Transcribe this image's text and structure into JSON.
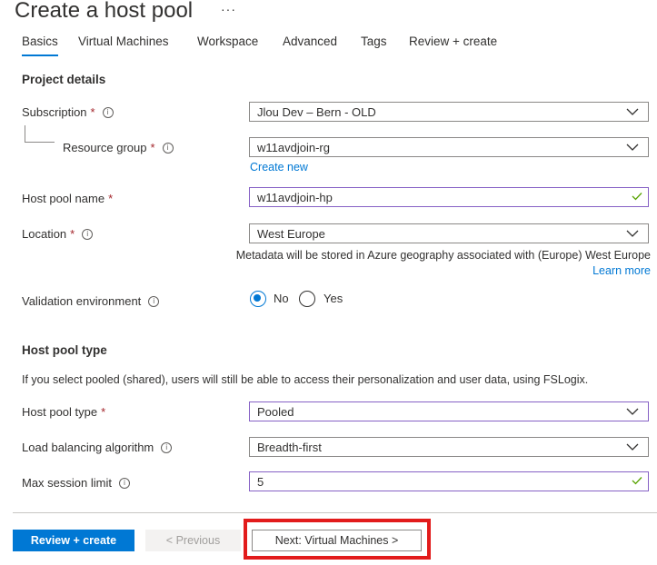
{
  "header": {
    "title": "Create a host pool",
    "more": "···"
  },
  "tabs": [
    {
      "label": "Basics"
    },
    {
      "label": "Virtual Machines"
    },
    {
      "label": "Workspace"
    },
    {
      "label": "Advanced"
    },
    {
      "label": "Tags"
    },
    {
      "label": "Review + create"
    }
  ],
  "project": {
    "heading": "Project details",
    "subscription": {
      "label": "Subscription",
      "value": "Jlou Dev – Bern - OLD"
    },
    "resource_group": {
      "label": "Resource group",
      "value": "w11avdjoin-rg",
      "create_new": "Create new"
    },
    "host_pool_name": {
      "label": "Host pool name",
      "value": "w11avdjoin-hp"
    },
    "location": {
      "label": "Location",
      "value": "West Europe",
      "note": "Metadata will be stored in Azure geography associated with (Europe) West Europe",
      "learn_more": "Learn more"
    },
    "validation": {
      "label": "Validation environment",
      "options": [
        "No",
        "Yes"
      ],
      "selected": "No"
    }
  },
  "pool_type": {
    "heading": "Host pool type",
    "description": "If you select pooled (shared), users will still be able to access their personalization and user data, using FSLogix.",
    "host_pool_type": {
      "label": "Host pool type",
      "value": "Pooled"
    },
    "load_balancing": {
      "label": "Load balancing algorithm",
      "value": "Breadth-first"
    },
    "max_session": {
      "label": "Max session limit",
      "value": "5"
    }
  },
  "footer": {
    "review_create": "Review + create",
    "previous": "< Previous",
    "next": "Next: Virtual Machines >"
  },
  "colors": {
    "accent": "#0078d4",
    "required": "#a4262c",
    "valid": "#57a300",
    "highlight": "#e21b1b",
    "field_focus": "#8661c5"
  },
  "icons": {
    "required_marker": "*",
    "info": "info-icon",
    "dropdown": "chevron-down-icon",
    "valid": "checkmark-icon"
  }
}
